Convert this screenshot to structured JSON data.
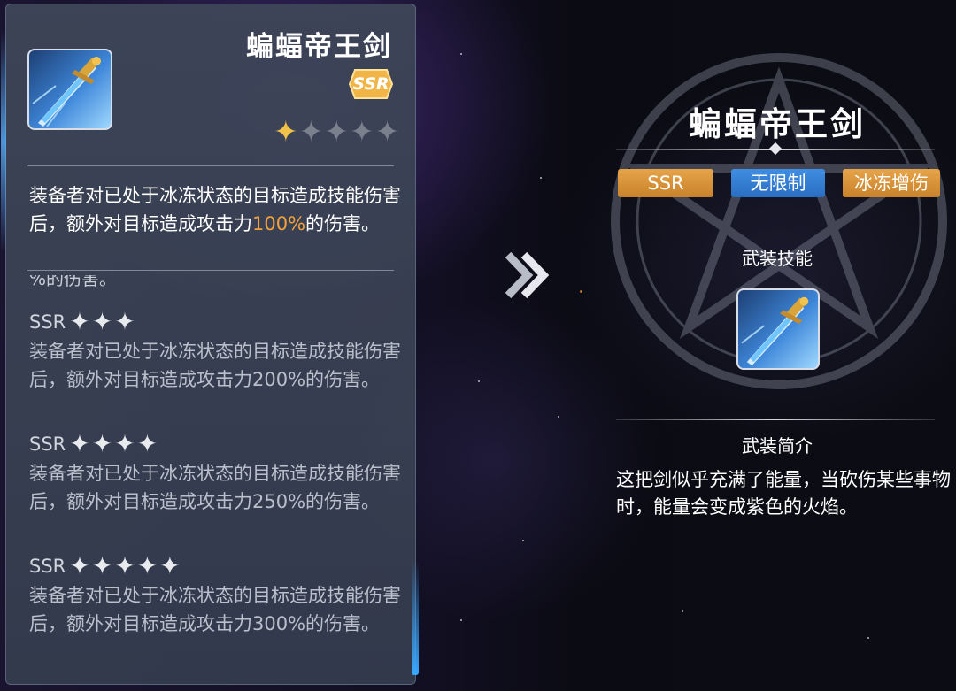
{
  "left_panel": {
    "title": "蝙蝠帝王剑",
    "rarity_badge": "SSR",
    "current_stars": 1,
    "max_stars": 5,
    "description_part1": "装备者对已处于冰冻状态的目标造成技能伤害后，额外对目标造成攻击力",
    "description_highlight": "100%",
    "description_part2": "的伤害。",
    "cut_text": "%的伤害。",
    "tiers": [
      {
        "label": "SSR",
        "stars": 3,
        "text": "装备者对已处于冰冻状态的目标造成技能伤害后，额外对目标造成攻击力200%的伤害。"
      },
      {
        "label": "SSR",
        "stars": 4,
        "text": "装备者对已处于冰冻状态的目标造成技能伤害后，额外对目标造成攻击力250%的伤害。"
      },
      {
        "label": "SSR",
        "stars": 5,
        "text": "装备者对已处于冰冻状态的目标造成技能伤害后，额外对目标造成攻击力300%的伤害。"
      }
    ]
  },
  "right_panel": {
    "title": "蝙蝠帝王剑",
    "tags": {
      "rarity": "SSR",
      "restriction": "无限制",
      "effect": "冰冻增伤"
    },
    "skill_label": "武装技能",
    "intro_label": "武装简介",
    "intro_text": "这把剑似乎充满了能量，当砍伤某些事物时，能量会变成紫色的火焰。"
  },
  "colors": {
    "panel": "#3e4658",
    "highlight": "#f2a23a",
    "tag_gold": "#d9933a",
    "tag_blue": "#3380d4",
    "star_gold": "#f0c24a",
    "star_empty": "#7a808c"
  },
  "icons": {
    "item": "sword-icon",
    "arrow": "double-chevron-right-icon",
    "star": "star-icon"
  }
}
